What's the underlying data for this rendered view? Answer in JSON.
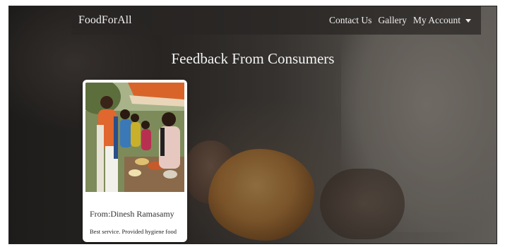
{
  "navbar": {
    "brand": "FoodForAll",
    "links": [
      {
        "label": "Contact Us"
      },
      {
        "label": "Gallery"
      },
      {
        "label": "My Account"
      }
    ]
  },
  "page": {
    "title": "Feedback From Consumers"
  },
  "feedback_cards": [
    {
      "from": "From:Dinesh Ramasamy",
      "text": "Best service. Provided hygiene food"
    }
  ],
  "icons": {
    "dropdown": "caret-down-icon"
  },
  "colors": {
    "card_background": "#ffffff",
    "nav_text": "#eeeeee",
    "title_text": "#f4f4f4"
  }
}
